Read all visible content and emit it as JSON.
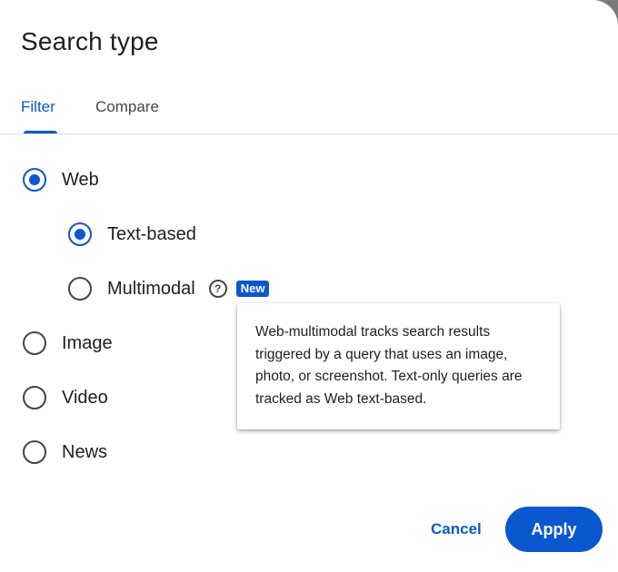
{
  "dialog": {
    "title": "Search type",
    "tabs": [
      {
        "label": "Filter",
        "selected": true
      },
      {
        "label": "Compare",
        "selected": false
      }
    ],
    "options": {
      "web": {
        "label": "Web",
        "checked": true
      },
      "text_based": {
        "label": "Text-based",
        "checked": true
      },
      "multimodal": {
        "label": "Multimodal",
        "checked": false,
        "help_icon": "question-mark-icon",
        "badge": "New"
      },
      "image": {
        "label": "Image",
        "checked": false
      },
      "video": {
        "label": "Video",
        "checked": false
      },
      "news": {
        "label": "News",
        "checked": false
      }
    },
    "tooltip": {
      "text": "Web-multimodal tracks search results triggered by a query that uses an image, photo, or screenshot. Text-only queries are tracked as Web text-based."
    },
    "actions": {
      "cancel_label": "Cancel",
      "apply_label": "Apply"
    },
    "colors": {
      "accent": "#0b57d0",
      "text": "#1f1f1f",
      "secondary_text": "#444746"
    }
  }
}
